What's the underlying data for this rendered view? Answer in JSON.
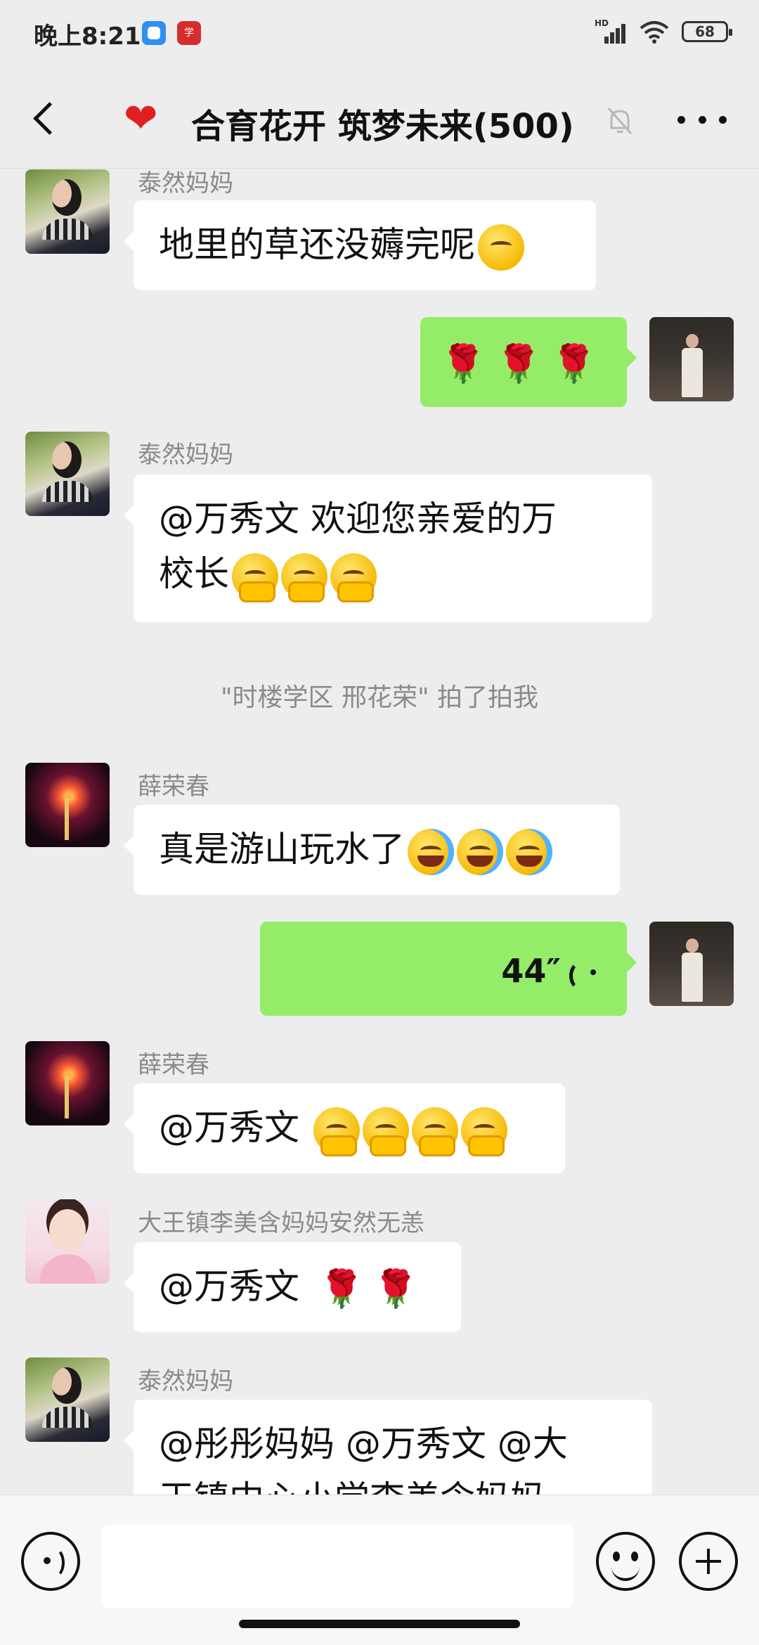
{
  "status_bar": {
    "time": "晚上8:21",
    "network": "HD",
    "battery": "68"
  },
  "header": {
    "title": "合育花开 筑梦未来(500)",
    "back_icon": "back-arrow-icon",
    "title_icon": "red-heart-icon",
    "mute_icon": "muted-bell-icon",
    "more_icon": "more-dots-icon"
  },
  "messages": [
    {
      "type": "text",
      "direction": "in",
      "sender": "泰然妈妈",
      "avatar": "woman",
      "text": "地里的草还没薅完呢",
      "emoji": [
        "thinking-face"
      ]
    },
    {
      "type": "emoji",
      "direction": "out",
      "avatar": "man",
      "text": "🌹🌹🌹"
    },
    {
      "type": "text",
      "direction": "in",
      "sender": "泰然妈妈",
      "avatar": "woman",
      "text_line1": "@万秀文  欢迎您亲爱的万",
      "text_line2": "校长",
      "emoji": [
        "shy-face",
        "shy-face",
        "shy-face"
      ]
    },
    {
      "type": "system",
      "text": "\"时楼学区  邢花荣\" 拍了拍我"
    },
    {
      "type": "text",
      "direction": "in",
      "sender": "薛荣春",
      "avatar": "firework",
      "text": "真是游山玩水了",
      "emoji": [
        "laugh-cry-face",
        "laugh-cry-face",
        "laugh-cry-face"
      ]
    },
    {
      "type": "voice",
      "direction": "out",
      "avatar": "man",
      "duration": "44″"
    },
    {
      "type": "text",
      "direction": "in",
      "sender": "薛荣春",
      "avatar": "firework",
      "text": "@万秀文 ",
      "emoji": [
        "shy-face",
        "shy-face",
        "shy-face",
        "shy-face"
      ]
    },
    {
      "type": "text",
      "direction": "in",
      "sender": "大王镇李美含妈妈安然无恙",
      "avatar": "girl",
      "text": "@万秀文 ",
      "roses": "🌹🌹"
    },
    {
      "type": "text",
      "direction": "in",
      "sender": "泰然妈妈",
      "avatar": "woman",
      "text_line1": "@彤彤妈妈 @万秀文 @大",
      "text_line2": "王镇中心小学李美含妈妈"
    }
  ],
  "input_bar": {
    "voice_icon": "voice-input-icon",
    "emoji_icon": "emoji-icon",
    "plus_icon": "plus-icon",
    "value": ""
  },
  "colors": {
    "background": "#ededed",
    "outgoing_bubble": "#95ec69",
    "incoming_bubble": "#ffffff",
    "sender_name": "#8a8a8a"
  }
}
